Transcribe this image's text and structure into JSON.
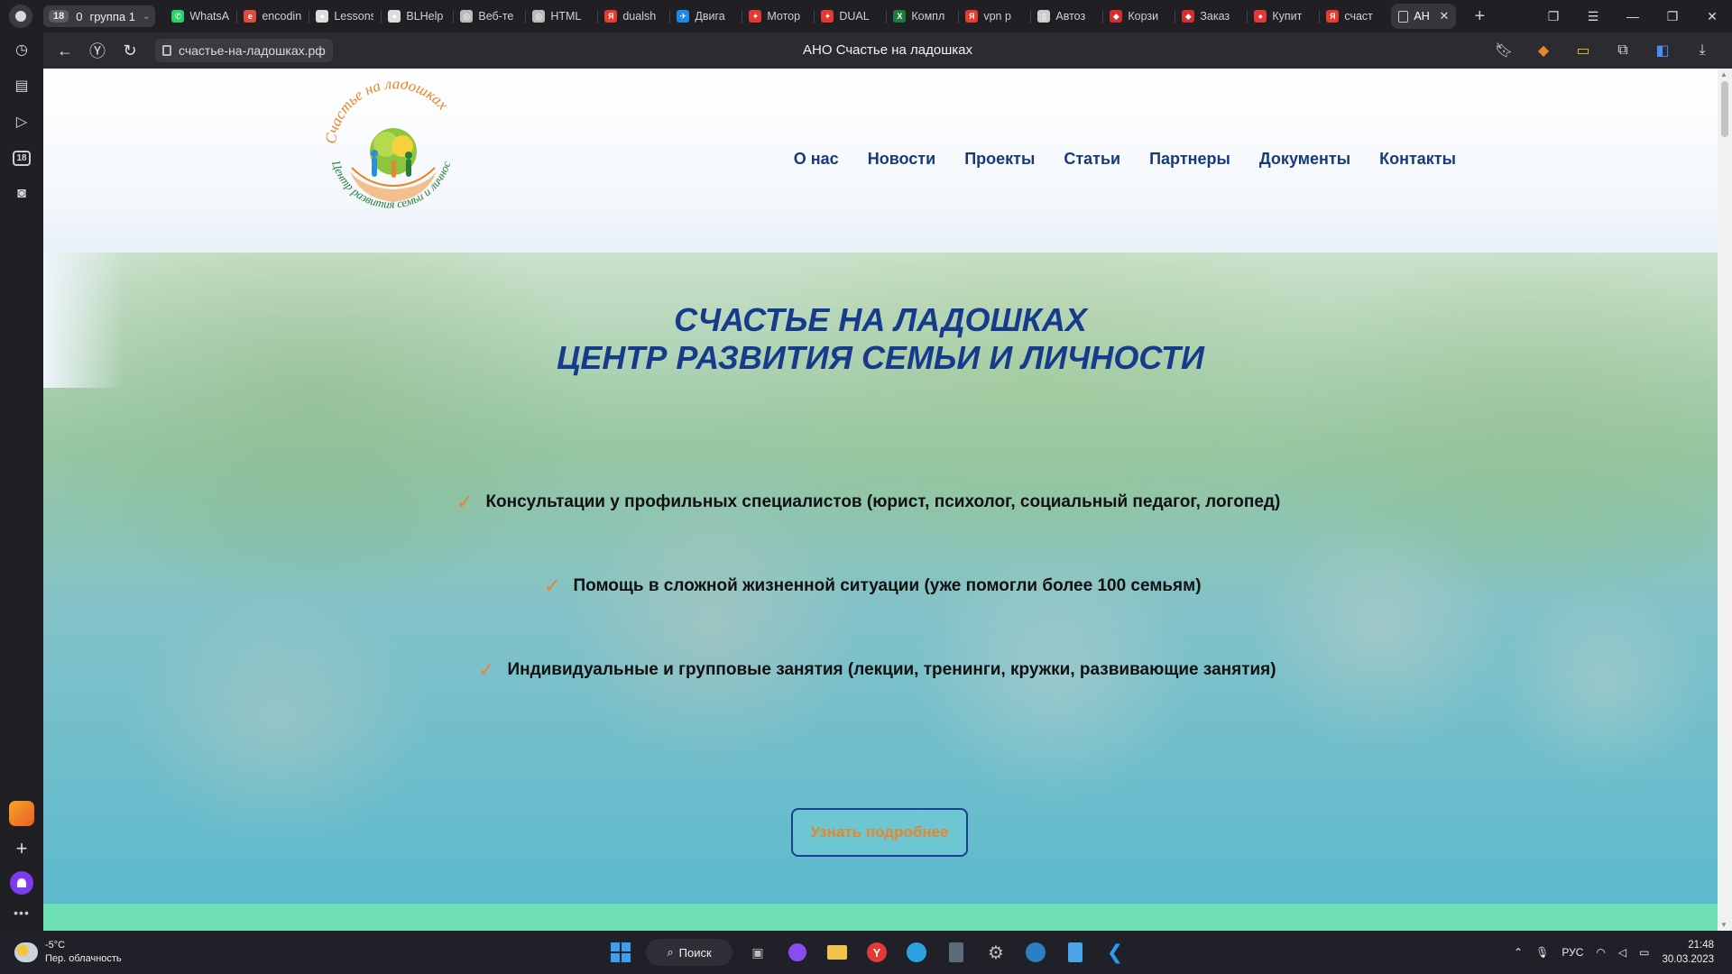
{
  "browser": {
    "group_label": "группа 1",
    "group_count": "0",
    "profile_badge": "18",
    "tabs": [
      {
        "title": "WhatsApp",
        "fav_color": "#25d366",
        "fav_glyph": "✆"
      },
      {
        "title": "encoding",
        "fav_color": "#e24a3b",
        "fav_glyph": "e"
      },
      {
        "title": "Lessons",
        "fav_color": "#dddddd",
        "fav_glyph": "●"
      },
      {
        "title": "BLHelp",
        "fav_color": "#dddddd",
        "fav_glyph": "●"
      },
      {
        "title": "Веб-те",
        "fav_color": "#bbbbbb",
        "fav_glyph": "◎"
      },
      {
        "title": "HTML",
        "fav_color": "#bbbbbb",
        "fav_glyph": "◎"
      },
      {
        "title": "dualsh",
        "fav_color": "#e63b2e",
        "fav_glyph": "Я"
      },
      {
        "title": "Двига",
        "fav_color": "#1e88e5",
        "fav_glyph": "✈"
      },
      {
        "title": "Мотор",
        "fav_color": "#e53935",
        "fav_glyph": "✦"
      },
      {
        "title": "DUAL",
        "fav_color": "#e53935",
        "fav_glyph": "✦"
      },
      {
        "title": "Компл",
        "fav_color": "#1e7b3e",
        "fav_glyph": "X"
      },
      {
        "title": "vpn р",
        "fav_color": "#e63b2e",
        "fav_glyph": "Я"
      },
      {
        "title": "Автоз",
        "fav_color": "#cccccc",
        "fav_glyph": "▯"
      },
      {
        "title": "Корзи",
        "fav_color": "#d32f2f",
        "fav_glyph": "◆"
      },
      {
        "title": "Заказ",
        "fav_color": "#d32f2f",
        "fav_glyph": "◆"
      },
      {
        "title": "Купит",
        "fav_color": "#e53935",
        "fav_glyph": "●"
      },
      {
        "title": "счаст",
        "fav_color": "#e63b2e",
        "fav_glyph": "Я"
      }
    ],
    "active_tab": {
      "title": "АН",
      "close_glyph": "✕"
    },
    "new_tab_glyph": "+",
    "url": "счастье-на-ладошках.рф",
    "page_title": "АНО Счастье на ладошках"
  },
  "sidebar": {
    "badge_18": "18"
  },
  "site": {
    "logo_alt": "Счастье на ладошках — Центр развития семьи и личности",
    "nav": [
      "О нас",
      "Новости",
      "Проекты",
      "Статьи",
      "Партнеры",
      "Документы",
      "Контакты"
    ],
    "hero": {
      "title_line1": "СЧАСТЬЕ НА ЛАДОШКАХ",
      "title_line2": "ЦЕНТР РАЗВИТИЯ СЕМЬИ И ЛИЧНОСТИ",
      "features": [
        "Консультации у профильных специалистов (юрист, психолог, социальный педагог, логопед)",
        "Помощь в сложной жизненной ситуации (уже помогли более 100 семьям)",
        "Индивидуальные и групповые занятия (лекции, тренинги, кружки, развивающие занятия)"
      ],
      "check_glyph": "✓",
      "button_label": "Узнать подробнее"
    },
    "colors": {
      "nav": "#183a7a",
      "title": "#163a8c",
      "accent": "#e9852a",
      "strip": "#6fe0b6"
    }
  },
  "taskbar": {
    "temperature": "-5°C",
    "weather": "Пер. облачность",
    "search_label": "Поиск",
    "language": "РУС",
    "time": "21:48",
    "date": "30.03.2023"
  }
}
